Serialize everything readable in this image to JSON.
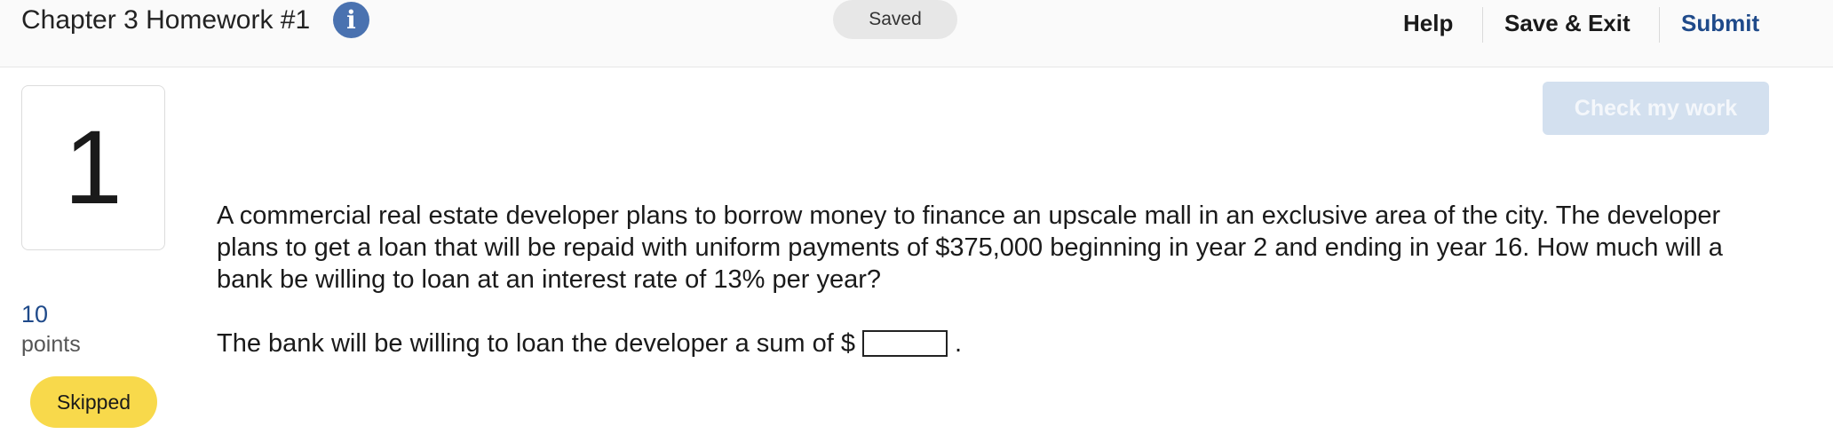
{
  "header": {
    "title": "Chapter 3 Homework #1",
    "info_icon": "info-icon",
    "status": "Saved",
    "nav": {
      "help": "Help",
      "save_exit": "Save & Exit",
      "submit": "Submit"
    }
  },
  "question_panel": {
    "number": "1",
    "points_value": "10",
    "points_label": "points",
    "status_badge": "Skipped"
  },
  "check_button": "Check my work",
  "question": {
    "text": "A commercial real estate developer plans to borrow money to finance an upscale mall in an exclusive area of the city. The developer plans to get a loan that will be repaid with uniform payments of $375,000 beginning in year 2 and ending in year 16. How much will a bank be willing to loan at an interest rate of 13% per year?",
    "answer_prefix": "The bank will be willing to loan the developer a sum of $",
    "answer_value": "",
    "answer_suffix": "."
  },
  "colors": {
    "accent": "#1f4a8a",
    "info_icon": "#4a72b0",
    "skipped_badge": "#f8d94b",
    "check_button_disabled": "#d3e0ef"
  }
}
